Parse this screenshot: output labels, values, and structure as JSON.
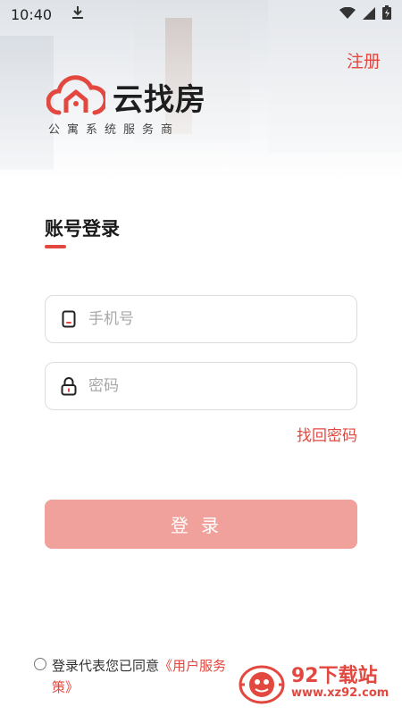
{
  "status_bar": {
    "time": "10:40"
  },
  "header": {
    "register_label": "注册"
  },
  "logo": {
    "name": "云找房",
    "tagline": "公寓系统服务商"
  },
  "login": {
    "title": "账号登录",
    "phone_placeholder": "手机号",
    "password_placeholder": "密码",
    "forgot_label": "找回密码",
    "button_label": "登录"
  },
  "agreement": {
    "prefix": "登录代表您已同意",
    "link_start": "《用户服务",
    "link_end": "策》"
  },
  "watermark": {
    "title": "92下载站",
    "url": "www.xz92.com"
  },
  "colors": {
    "accent": "#e2483f",
    "button_disabled": "#f0a19b"
  }
}
